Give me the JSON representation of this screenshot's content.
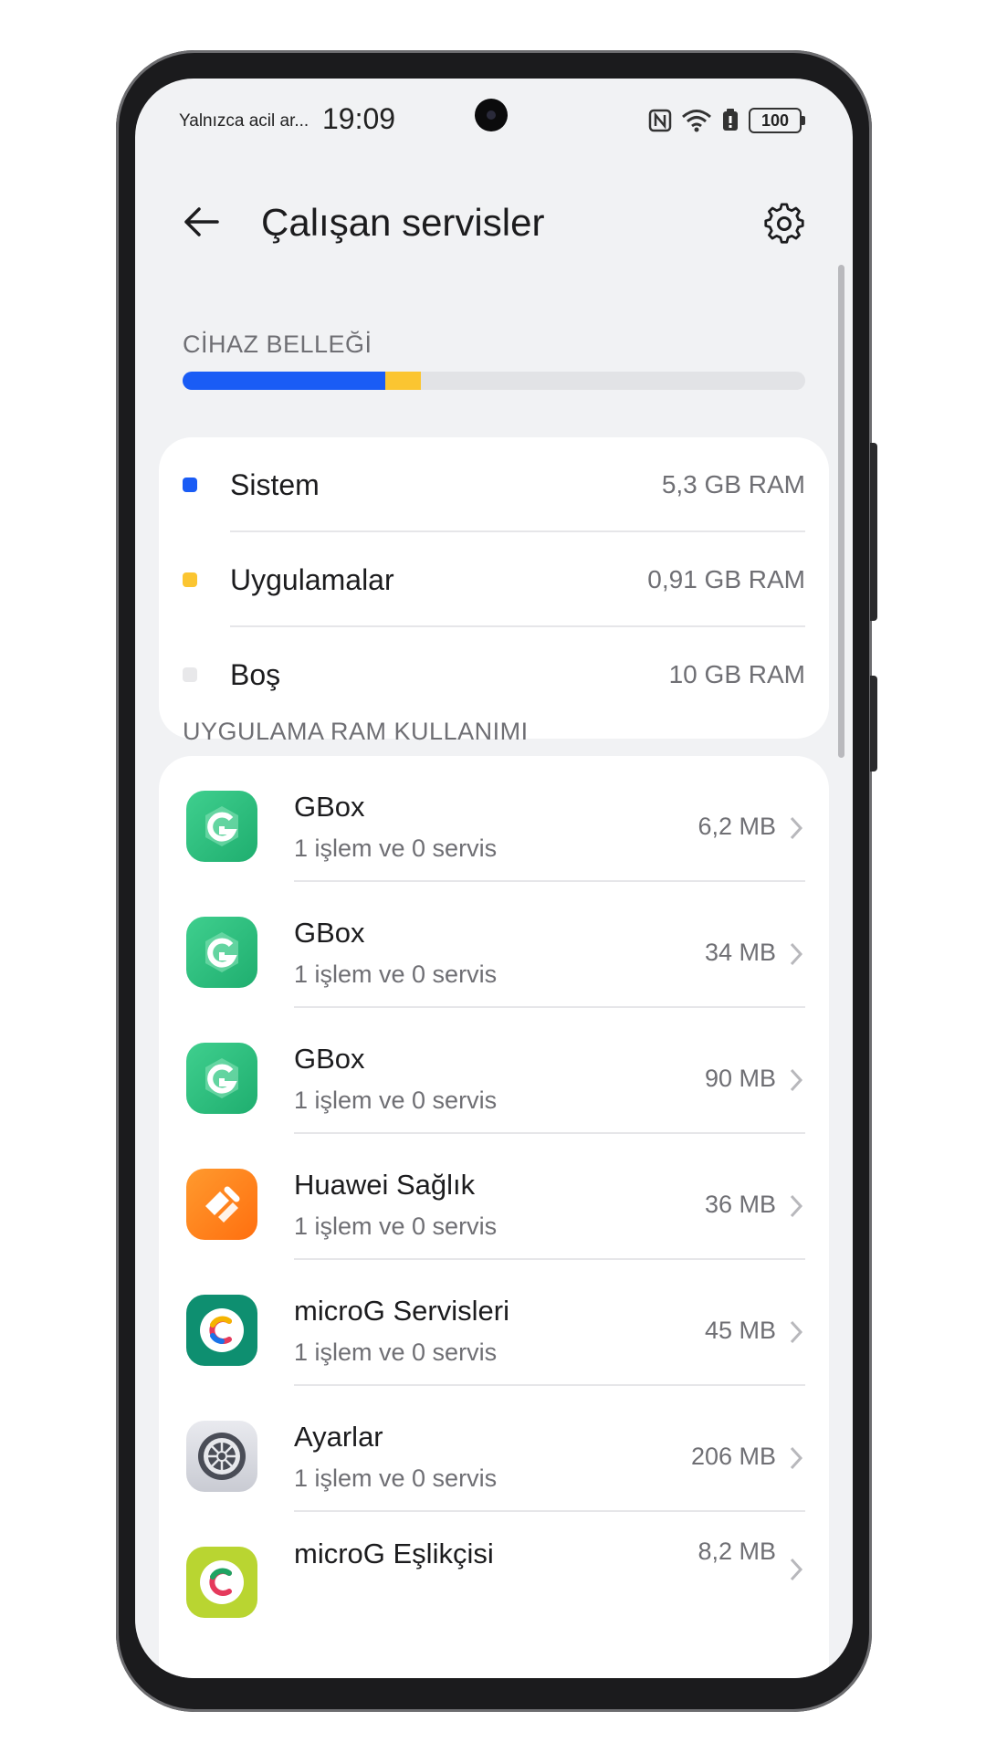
{
  "status_bar": {
    "carrier": "Yalnızca acil ar...",
    "time": "19:09",
    "battery": "100",
    "icons": [
      "nfc-icon",
      "wifi-icon",
      "battery-saver-icon",
      "battery-icon"
    ]
  },
  "header": {
    "title": "Çalışan servisler",
    "back_icon": "back-arrow-icon",
    "settings_icon": "gear-icon"
  },
  "memory": {
    "section_label": "CİHAZ BELLEĞİ",
    "bar_fraction": {
      "system": 0.326,
      "apps": 0.056
    },
    "items": [
      {
        "label": "Sistem",
        "value": "5,3 GB RAM",
        "color": "#1a5cf5"
      },
      {
        "label": "Uygulamalar",
        "value": "0,91 GB RAM",
        "color": "#fbc531"
      },
      {
        "label": "Boş",
        "value": "10 GB RAM",
        "color": "#e8e8ea"
      }
    ]
  },
  "apps": {
    "section_label": "UYGULAMA RAM KULLANIMI",
    "items": [
      {
        "name": "GBox",
        "sub": "1 işlem ve 0 servis",
        "size": "6,2 MB",
        "icon": "gbox-icon"
      },
      {
        "name": "GBox",
        "sub": "1 işlem ve 0 servis",
        "size": "34 MB",
        "icon": "gbox-icon"
      },
      {
        "name": "GBox",
        "sub": "1 işlem ve 0 servis",
        "size": "90 MB",
        "icon": "gbox-icon"
      },
      {
        "name": "Huawei Sağlık",
        "sub": "1 işlem ve 0 servis",
        "size": "36 MB",
        "icon": "huawei-health-icon"
      },
      {
        "name": "microG Servisleri",
        "sub": "1 işlem ve 0 servis",
        "size": "45 MB",
        "icon": "microg-icon"
      },
      {
        "name": "Ayarlar",
        "sub": "1 işlem ve 0 servis",
        "size": "206 MB",
        "icon": "settings-app-icon"
      },
      {
        "name": "microG Eşlikçisi",
        "sub": "",
        "size": "8,2 MB",
        "icon": "microg-companion-icon"
      }
    ]
  }
}
